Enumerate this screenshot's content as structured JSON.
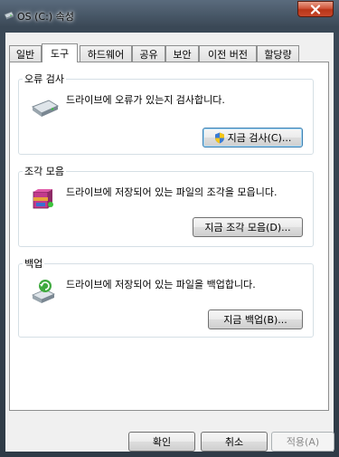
{
  "window": {
    "title": "OS (C:) 속성"
  },
  "tabs": [
    {
      "label": "일반"
    },
    {
      "label": "도구"
    },
    {
      "label": "하드웨어"
    },
    {
      "label": "공유"
    },
    {
      "label": "보안"
    },
    {
      "label": "이전 버전"
    },
    {
      "label": "할당량"
    }
  ],
  "active_tab": "도구",
  "groups": {
    "error_check": {
      "label": "오류 검사",
      "description": "드라이브에 오류가 있는지 검사합니다.",
      "button": "지금 검사(C)...",
      "icon": "drive-check-icon"
    },
    "defrag": {
      "label": "조각 모음",
      "description": "드라이브에 저장되어 있는 파일의 조각을 모읍니다.",
      "button": "지금 조각 모음(D)...",
      "icon": "defrag-icon"
    },
    "backup": {
      "label": "백업",
      "description": "드라이브에 저장되어 있는 파일을 백업합니다.",
      "button": "지금 백업(B)...",
      "icon": "backup-icon"
    }
  },
  "footer": {
    "ok": "확인",
    "cancel": "취소",
    "apply": "적용(A)"
  },
  "colors": {
    "close_button": "#c8482c",
    "focus_border": "#3c7fb1"
  }
}
